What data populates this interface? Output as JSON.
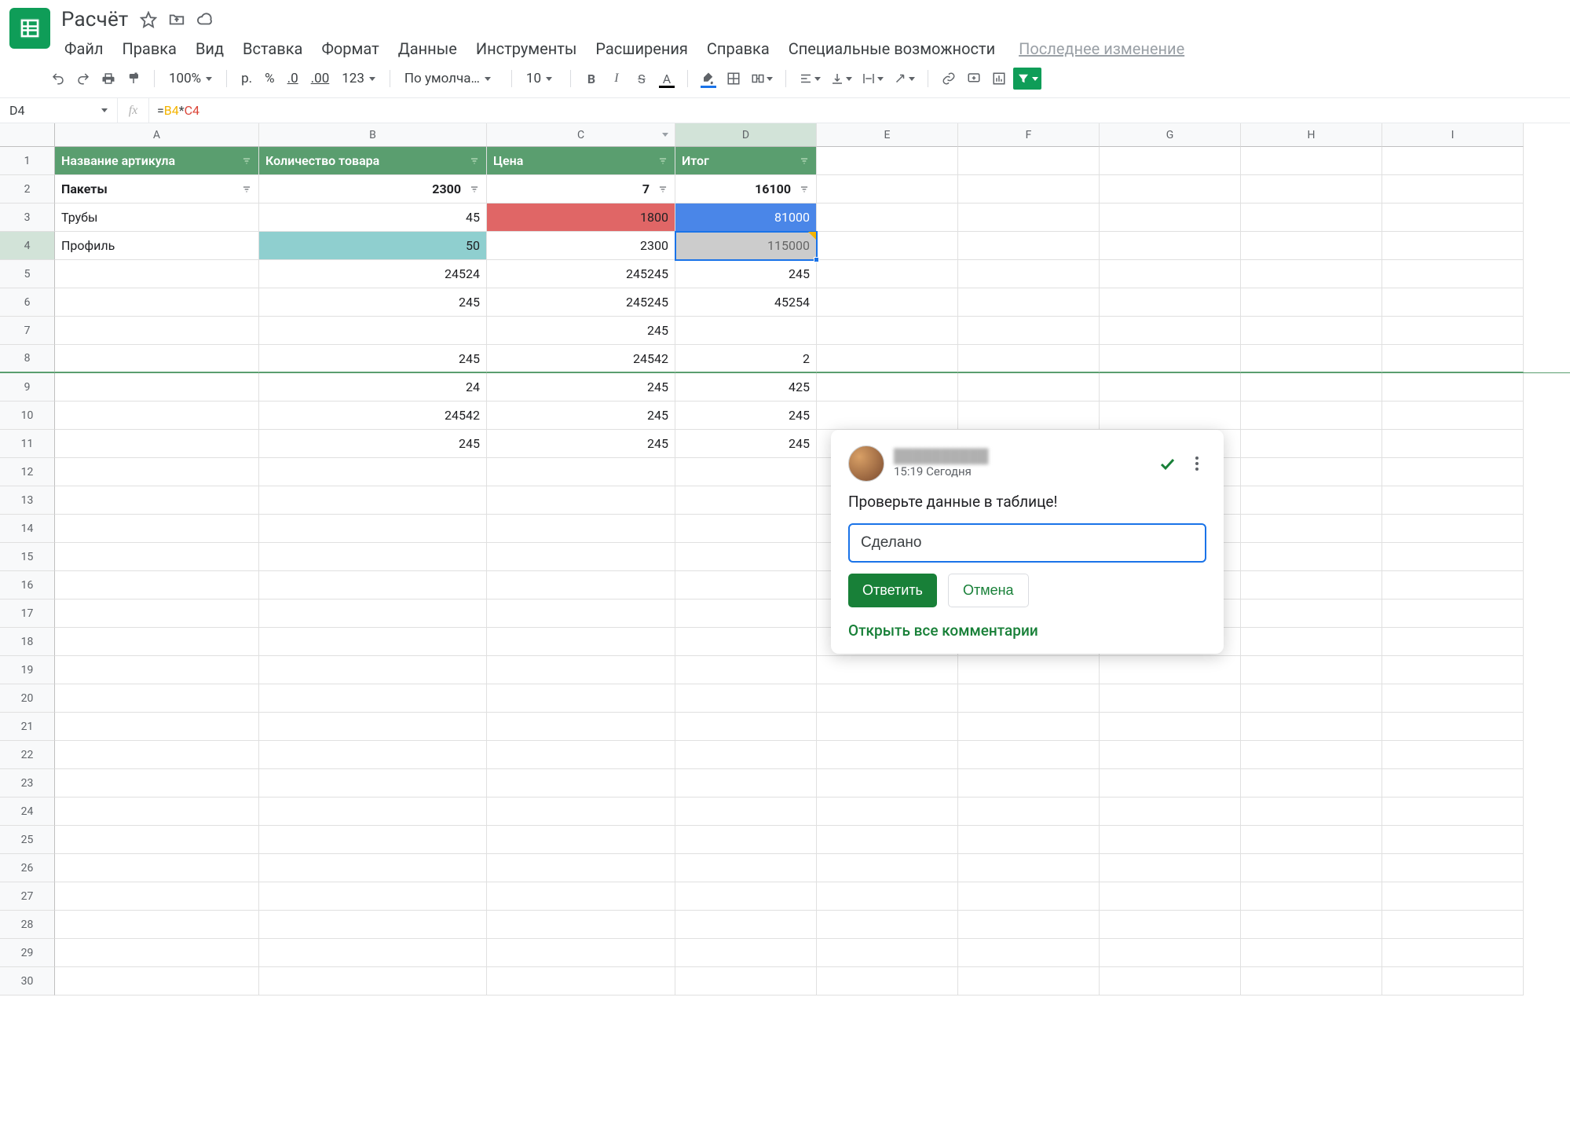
{
  "doc": {
    "title": "Расчёт",
    "last_edit": "Последнее изменение"
  },
  "menus": {
    "file": "Файл",
    "edit": "Правка",
    "view": "Вид",
    "insert": "Вставка",
    "format": "Формат",
    "data": "Данные",
    "tools": "Инструменты",
    "extensions": "Расширения",
    "help": "Справка",
    "accessibility": "Специальные возможности"
  },
  "toolbar": {
    "zoom": "100%",
    "currency": "р.",
    "percent": "%",
    "dec_less": ".0",
    "dec_more": ".00",
    "num_fmt": "123",
    "font": "По умолча…",
    "font_size": "10"
  },
  "formula": {
    "cell_ref": "D4",
    "eq": "=",
    "refB": "B4",
    "star": "*",
    "refC": "C4"
  },
  "columns": [
    "A",
    "B",
    "C",
    "D",
    "E",
    "F",
    "G",
    "H",
    "I"
  ],
  "headers": {
    "a": "Название артикула",
    "b": "Количество товара",
    "c": "Цена",
    "d": "Итог"
  },
  "rows": [
    {
      "n": "1"
    },
    {
      "n": "2",
      "a": "Пакеты",
      "b": "2300",
      "c": "7",
      "d": "16100",
      "bold": true
    },
    {
      "n": "3",
      "a": "Трубы",
      "b": "45",
      "c": "1800",
      "d": "81000"
    },
    {
      "n": "4",
      "a": "Профиль",
      "b": "50",
      "c": "2300",
      "d": "115000"
    },
    {
      "n": "5",
      "a": "",
      "b": "24524",
      "c": "245245",
      "d": "245"
    },
    {
      "n": "6",
      "a": "",
      "b": "245",
      "c": "245245",
      "d": "45254"
    },
    {
      "n": "7",
      "a": "",
      "b": "",
      "c": "245",
      "d": ""
    },
    {
      "n": "8",
      "a": "",
      "b": "245",
      "c": "24542",
      "d": "2"
    },
    {
      "n": "9",
      "a": "",
      "b": "24",
      "c": "245",
      "d": "425"
    },
    {
      "n": "10",
      "a": "",
      "b": "24542",
      "c": "245",
      "d": "245"
    },
    {
      "n": "11",
      "a": "",
      "b": "245",
      "c": "245",
      "d": "245"
    }
  ],
  "comment": {
    "author": "██████████",
    "time": "15:19 Сегодня",
    "body": "Проверьте данные в таблице!",
    "reply_value": "Сделано",
    "reply_btn": "Ответить",
    "cancel_btn": "Отмена",
    "open_all": "Открыть все комментарии"
  }
}
